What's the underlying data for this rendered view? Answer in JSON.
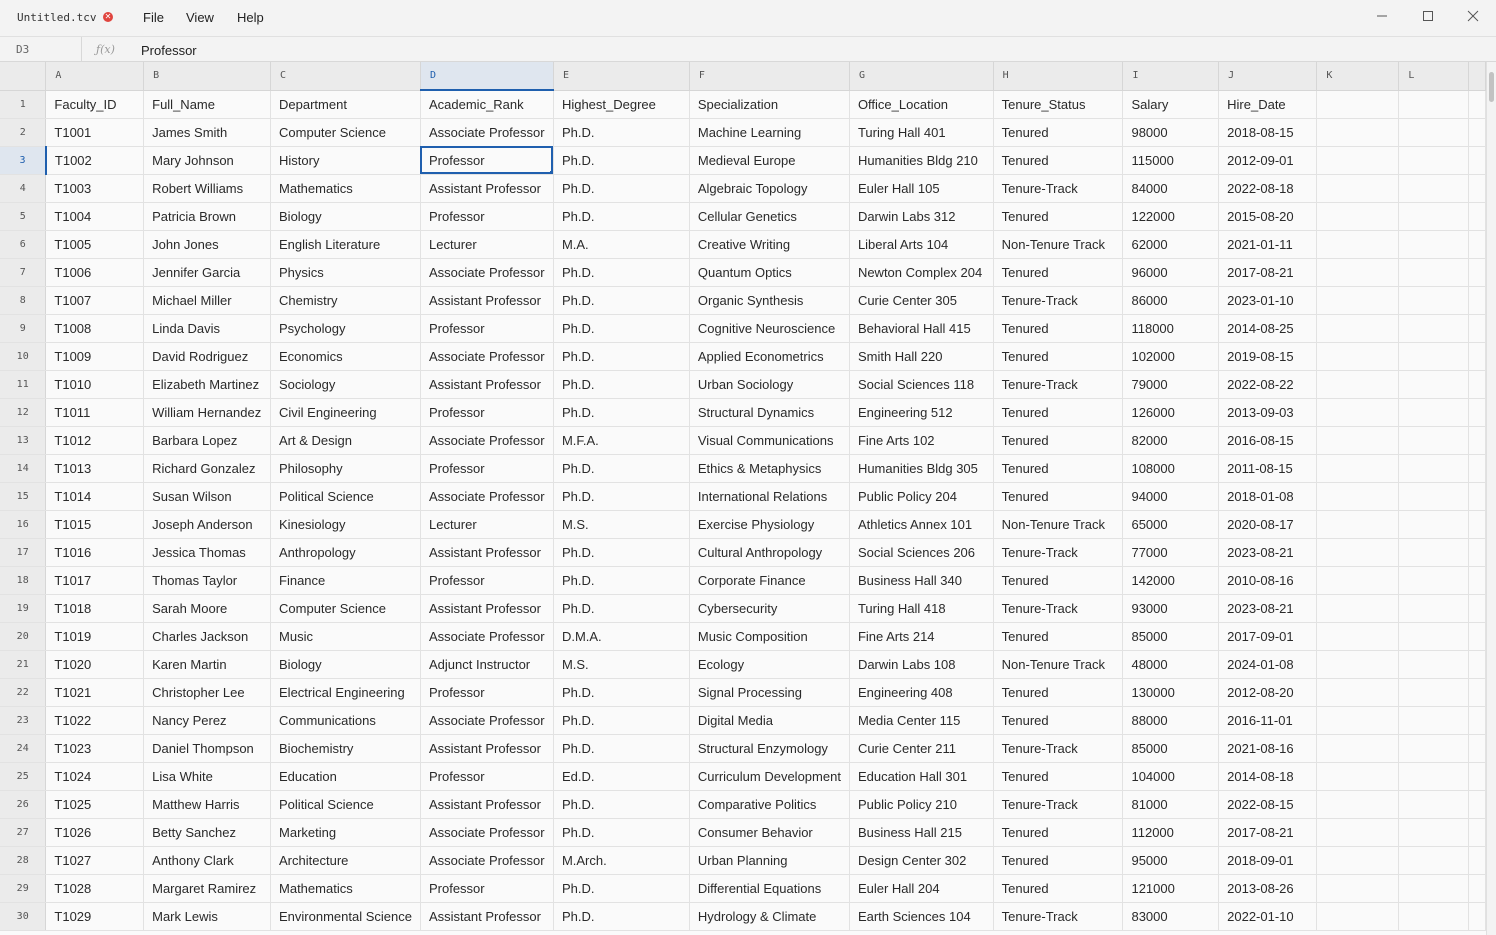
{
  "window": {
    "title": "Untitled.tcv"
  },
  "menu": [
    "File",
    "View",
    "Help"
  ],
  "formula_bar": {
    "cell_ref": "D3",
    "fx_label": "ƒ(x)",
    "value": "Professor"
  },
  "columns": [
    "A",
    "B",
    "C",
    "D",
    "E",
    "F",
    "G",
    "H",
    "I",
    "J",
    "K",
    "L"
  ],
  "active": {
    "row": 3,
    "col": "D"
  },
  "rows": [
    [
      "Faculty_ID",
      "Full_Name",
      "Department",
      "Academic_Rank",
      "Highest_Degree",
      "Specialization",
      "Office_Location",
      "Tenure_Status",
      "Salary",
      "Hire_Date"
    ],
    [
      "T1001",
      "James Smith",
      "Computer Science",
      "Associate Professor",
      "Ph.D.",
      "Machine Learning",
      "Turing Hall 401",
      "Tenured",
      "98000",
      "2018-08-15"
    ],
    [
      "T1002",
      "Mary Johnson",
      "History",
      "Professor",
      "Ph.D.",
      "Medieval Europe",
      "Humanities Bldg 210",
      "Tenured",
      "115000",
      "2012-09-01"
    ],
    [
      "T1003",
      "Robert Williams",
      "Mathematics",
      "Assistant Professor",
      "Ph.D.",
      "Algebraic Topology",
      "Euler Hall 105",
      "Tenure-Track",
      "84000",
      "2022-08-18"
    ],
    [
      "T1004",
      "Patricia Brown",
      "Biology",
      "Professor",
      "Ph.D.",
      "Cellular Genetics",
      "Darwin Labs 312",
      "Tenured",
      "122000",
      "2015-08-20"
    ],
    [
      "T1005",
      "John Jones",
      "English Literature",
      "Lecturer",
      "M.A.",
      "Creative Writing",
      "Liberal Arts 104",
      "Non-Tenure Track",
      "62000",
      "2021-01-11"
    ],
    [
      "T1006",
      "Jennifer Garcia",
      "Physics",
      "Associate Professor",
      "Ph.D.",
      "Quantum Optics",
      "Newton Complex 204",
      "Tenured",
      "96000",
      "2017-08-21"
    ],
    [
      "T1007",
      "Michael Miller",
      "Chemistry",
      "Assistant Professor",
      "Ph.D.",
      "Organic Synthesis",
      "Curie Center 305",
      "Tenure-Track",
      "86000",
      "2023-01-10"
    ],
    [
      "T1008",
      "Linda Davis",
      "Psychology",
      "Professor",
      "Ph.D.",
      "Cognitive Neuroscience",
      "Behavioral Hall 415",
      "Tenured",
      "118000",
      "2014-08-25"
    ],
    [
      "T1009",
      "David Rodriguez",
      "Economics",
      "Associate Professor",
      "Ph.D.",
      "Applied Econometrics",
      "Smith Hall 220",
      "Tenured",
      "102000",
      "2019-08-15"
    ],
    [
      "T1010",
      "Elizabeth Martinez",
      "Sociology",
      "Assistant Professor",
      "Ph.D.",
      "Urban Sociology",
      "Social Sciences 118",
      "Tenure-Track",
      "79000",
      "2022-08-22"
    ],
    [
      "T1011",
      "William Hernandez",
      "Civil Engineering",
      "Professor",
      "Ph.D.",
      "Structural Dynamics",
      "Engineering 512",
      "Tenured",
      "126000",
      "2013-09-03"
    ],
    [
      "T1012",
      "Barbara Lopez",
      "Art & Design",
      "Associate Professor",
      "M.F.A.",
      "Visual Communications",
      "Fine Arts 102",
      "Tenured",
      "82000",
      "2016-08-15"
    ],
    [
      "T1013",
      "Richard Gonzalez",
      "Philosophy",
      "Professor",
      "Ph.D.",
      "Ethics & Metaphysics",
      "Humanities Bldg 305",
      "Tenured",
      "108000",
      "2011-08-15"
    ],
    [
      "T1014",
      "Susan Wilson",
      "Political Science",
      "Associate Professor",
      "Ph.D.",
      "International Relations",
      "Public Policy 204",
      "Tenured",
      "94000",
      "2018-01-08"
    ],
    [
      "T1015",
      "Joseph Anderson",
      "Kinesiology",
      "Lecturer",
      "M.S.",
      "Exercise Physiology",
      "Athletics Annex 101",
      "Non-Tenure Track",
      "65000",
      "2020-08-17"
    ],
    [
      "T1016",
      "Jessica Thomas",
      "Anthropology",
      "Assistant Professor",
      "Ph.D.",
      "Cultural Anthropology",
      "Social Sciences 206",
      "Tenure-Track",
      "77000",
      "2023-08-21"
    ],
    [
      "T1017",
      "Thomas Taylor",
      "Finance",
      "Professor",
      "Ph.D.",
      "Corporate Finance",
      "Business Hall 340",
      "Tenured",
      "142000",
      "2010-08-16"
    ],
    [
      "T1018",
      "Sarah Moore",
      "Computer Science",
      "Assistant Professor",
      "Ph.D.",
      "Cybersecurity",
      "Turing Hall 418",
      "Tenure-Track",
      "93000",
      "2023-08-21"
    ],
    [
      "T1019",
      "Charles Jackson",
      "Music",
      "Associate Professor",
      "D.M.A.",
      "Music Composition",
      "Fine Arts 214",
      "Tenured",
      "85000",
      "2017-09-01"
    ],
    [
      "T1020",
      "Karen Martin",
      "Biology",
      "Adjunct Instructor",
      "M.S.",
      "Ecology",
      "Darwin Labs 108",
      "Non-Tenure Track",
      "48000",
      "2024-01-08"
    ],
    [
      "T1021",
      "Christopher Lee",
      "Electrical Engineering",
      "Professor",
      "Ph.D.",
      "Signal Processing",
      "Engineering 408",
      "Tenured",
      "130000",
      "2012-08-20"
    ],
    [
      "T1022",
      "Nancy Perez",
      "Communications",
      "Associate Professor",
      "Ph.D.",
      "Digital Media",
      "Media Center 115",
      "Tenured",
      "88000",
      "2016-11-01"
    ],
    [
      "T1023",
      "Daniel Thompson",
      "Biochemistry",
      "Assistant Professor",
      "Ph.D.",
      "Structural Enzymology",
      "Curie Center 211",
      "Tenure-Track",
      "85000",
      "2021-08-16"
    ],
    [
      "T1024",
      "Lisa White",
      "Education",
      "Professor",
      "Ed.D.",
      "Curriculum Development",
      "Education Hall 301",
      "Tenured",
      "104000",
      "2014-08-18"
    ],
    [
      "T1025",
      "Matthew Harris",
      "Political Science",
      "Assistant Professor",
      "Ph.D.",
      "Comparative Politics",
      "Public Policy 210",
      "Tenure-Track",
      "81000",
      "2022-08-15"
    ],
    [
      "T1026",
      "Betty Sanchez",
      "Marketing",
      "Associate Professor",
      "Ph.D.",
      "Consumer Behavior",
      "Business Hall 215",
      "Tenured",
      "112000",
      "2017-08-21"
    ],
    [
      "T1027",
      "Anthony Clark",
      "Architecture",
      "Associate Professor",
      "M.Arch.",
      "Urban Planning",
      "Design Center 302",
      "Tenured",
      "95000",
      "2018-09-01"
    ],
    [
      "T1028",
      "Margaret Ramirez",
      "Mathematics",
      "Professor",
      "Ph.D.",
      "Differential Equations",
      "Euler Hall 204",
      "Tenured",
      "121000",
      "2013-08-26"
    ],
    [
      "T1029",
      "Mark Lewis",
      "Environmental Science",
      "Assistant Professor",
      "Ph.D.",
      "Hydrology & Climate",
      "Earth Sciences 104",
      "Tenure-Track",
      "83000",
      "2022-01-10"
    ]
  ]
}
